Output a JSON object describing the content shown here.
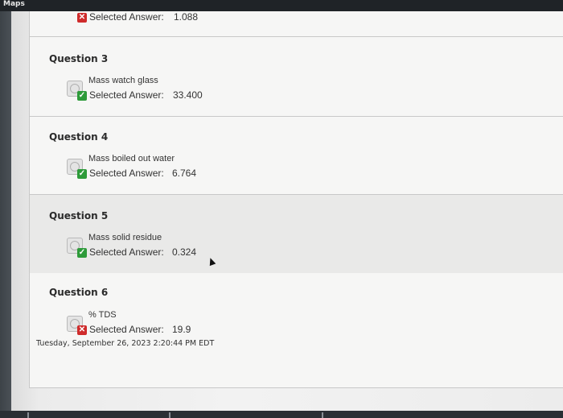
{
  "top_bar": {
    "app_label": "Maps"
  },
  "prev_question": {
    "selected_label": "Selected Answer:",
    "selected_value": "1.088",
    "result": "incorrect"
  },
  "questions": [
    {
      "title": "Question 3",
      "prompt": "Mass watch glass",
      "selected_label": "Selected Answer:",
      "selected_value": "33.400",
      "result": "correct"
    },
    {
      "title": "Question 4",
      "prompt": "Mass boiled out water",
      "selected_label": "Selected Answer:",
      "selected_value": "6.764",
      "result": "correct"
    },
    {
      "title": "Question 5",
      "prompt": "Mass solid residue",
      "selected_label": "Selected Answer:",
      "selected_value": "0.324",
      "result": "correct"
    },
    {
      "title": "Question 6",
      "prompt": "% TDS",
      "selected_label": "Selected Answer:",
      "selected_value": "19.9",
      "result": "incorrect"
    }
  ],
  "timestamp": "Tuesday, September 26, 2023 2:20:44 PM EDT",
  "colors": {
    "correct": "#2e9b3a",
    "incorrect": "#cf2b2b"
  },
  "icons": {
    "correct": "check-icon",
    "incorrect": "x-icon"
  }
}
